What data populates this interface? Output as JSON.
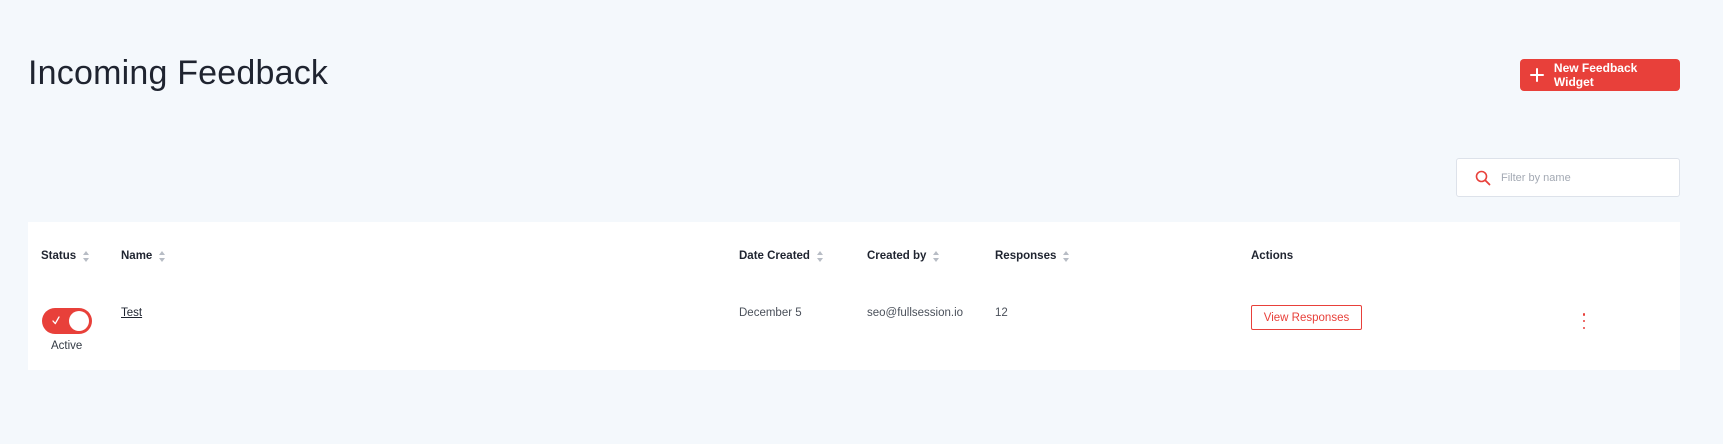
{
  "page": {
    "title": "Incoming Feedback"
  },
  "header": {
    "new_widget_label": "New Feedback Widget",
    "new_widget_icon": "plus-icon"
  },
  "search": {
    "placeholder": "Filter by name",
    "value": "",
    "icon": "search-icon"
  },
  "table": {
    "columns": {
      "status": "Status",
      "name": "Name",
      "date_created": "Date Created",
      "created_by": "Created by",
      "responses": "Responses",
      "actions": "Actions"
    },
    "rows": [
      {
        "active": true,
        "status_text": "Active",
        "name": "Test",
        "date_created": "December 5",
        "created_by": "seo@fullsession.io",
        "responses": "12",
        "view_label": "View Responses",
        "more_icon": "kebab-menu-icon"
      }
    ]
  },
  "colors": {
    "accent": "#e8403a",
    "background": "#f4f8fc",
    "card": "#ffffff",
    "text": "#1f2430"
  }
}
